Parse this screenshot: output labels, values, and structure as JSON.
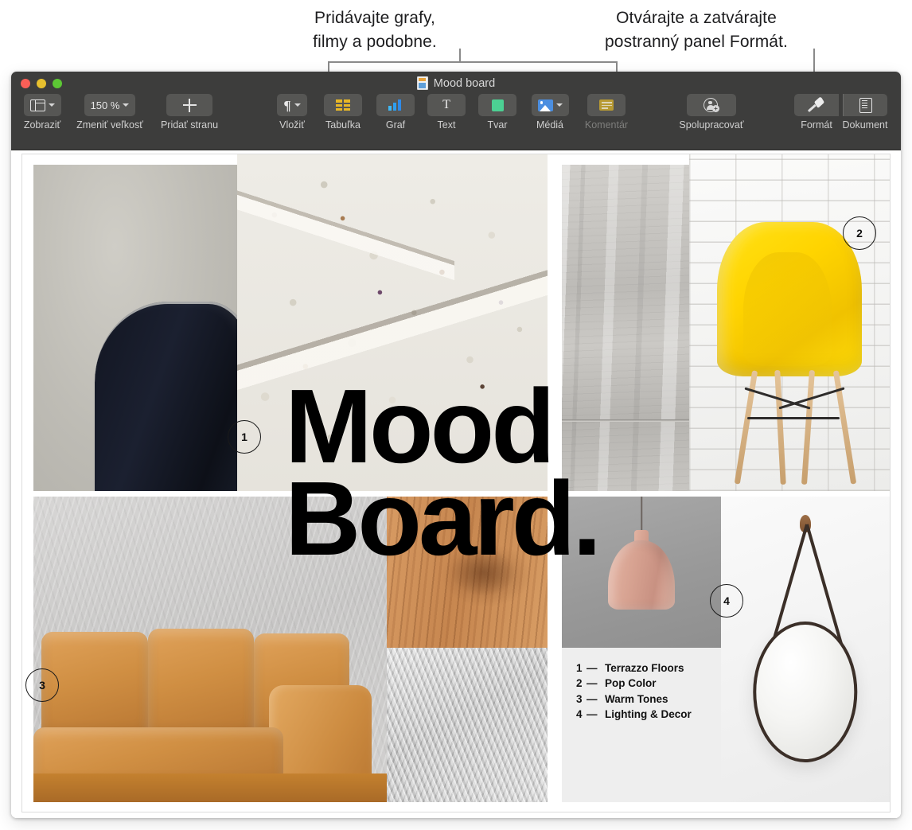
{
  "callouts": {
    "left": "Pridávajte grafy,\nfilmy a podobne.",
    "right": "Otvárajte a zatvárajte\npostranný panel Formát."
  },
  "window": {
    "title": "Mood board",
    "traffic_lights": [
      "close",
      "minimize",
      "zoom"
    ]
  },
  "toolbar": {
    "items": [
      {
        "name": "view",
        "label": "Zobraziť",
        "icon": "view-panel-icon",
        "value": "",
        "has_chevron": true,
        "dimmed": false
      },
      {
        "name": "zoom",
        "label": "Zmeniť veľkosť",
        "icon": "zoom-level-icon",
        "value": "150 %",
        "has_chevron": true,
        "dimmed": false
      },
      {
        "name": "add-page",
        "label": "Pridať stranu",
        "icon": "plus-icon",
        "value": "",
        "has_chevron": false,
        "dimmed": false
      },
      {
        "name": "insert",
        "label": "Vložiť",
        "icon": "paragraph-icon",
        "value": "",
        "has_chevron": true,
        "dimmed": false
      },
      {
        "name": "table",
        "label": "Tabuľka",
        "icon": "table-icon",
        "value": "",
        "has_chevron": false,
        "dimmed": false
      },
      {
        "name": "chart",
        "label": "Graf",
        "icon": "bar-chart-icon",
        "value": "",
        "has_chevron": false,
        "dimmed": false
      },
      {
        "name": "text",
        "label": "Text",
        "icon": "text-t-icon",
        "value": "",
        "has_chevron": false,
        "dimmed": false
      },
      {
        "name": "shape",
        "label": "Tvar",
        "icon": "shape-square-icon",
        "value": "",
        "has_chevron": false,
        "dimmed": false
      },
      {
        "name": "media",
        "label": "Médiá",
        "icon": "media-image-icon",
        "value": "",
        "has_chevron": true,
        "dimmed": false
      },
      {
        "name": "comment",
        "label": "Komentár",
        "icon": "comment-icon",
        "value": "",
        "has_chevron": false,
        "dimmed": true
      },
      {
        "name": "collaborate",
        "label": "Spolupracovať",
        "icon": "add-person-icon",
        "value": "",
        "has_chevron": false,
        "dimmed": false
      },
      {
        "name": "format",
        "label": "Formát",
        "icon": "format-brush-icon",
        "value": "",
        "has_chevron": false,
        "dimmed": false
      },
      {
        "name": "document",
        "label": "Dokument",
        "icon": "document-icon",
        "value": "",
        "has_chevron": false,
        "dimmed": false
      }
    ]
  },
  "document": {
    "title": "Mood\nBoard.",
    "markers": [
      {
        "label": "1"
      },
      {
        "label": "2"
      },
      {
        "label": "3"
      },
      {
        "label": "4"
      }
    ],
    "legend": [
      {
        "num": "1",
        "dash": "—",
        "label": "Terrazzo Floors"
      },
      {
        "num": "2",
        "dash": "—",
        "label": "Pop Color"
      },
      {
        "num": "3",
        "dash": "—",
        "label": "Warm Tones"
      },
      {
        "num": "4",
        "dash": "—",
        "label": "Lighting & Decor"
      }
    ],
    "tiles": [
      {
        "name": "image-gray-wall-chair"
      },
      {
        "name": "image-terrazzo-slab"
      },
      {
        "name": "image-concrete-wall"
      },
      {
        "name": "image-yellow-chair"
      },
      {
        "name": "image-plaster-leather-sofa"
      },
      {
        "name": "image-wood-grain"
      },
      {
        "name": "image-fur-texture"
      },
      {
        "name": "image-pendant-lamp"
      },
      {
        "name": "legend-panel"
      },
      {
        "name": "image-round-mirror"
      }
    ]
  },
  "colors": {
    "toolbar_bg": "#3d3d3c",
    "toolbar_button": "#565654",
    "accent_yellow": "#ffd400",
    "page_bg": "#ffffff",
    "title_black": "#000000"
  }
}
